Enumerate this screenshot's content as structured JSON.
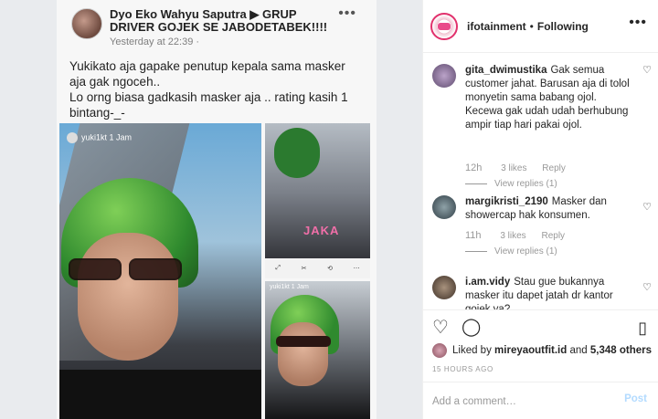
{
  "fb_post": {
    "header": "Dyo Eko Wahyu Saputra ▶ GRUP DRIVER GOJEK SE JABODETABEK!!!!",
    "time": "Yesterday at 22:39 · ",
    "more": "•••",
    "body": "Yukikato aja gapake penutup kepala sama masker aja gak ngoceh..\nLo orng biasa gadkasih masker aja .. rating kasih 1 bintang-_-",
    "photo_main_user": "yuki1kt 1 Jam",
    "photo_r1_text": "JAKA",
    "photo_r2_user": "yuki1kt 1 Jam"
  },
  "instagram": {
    "username": "ifotainment",
    "separator": "•",
    "follow_status": "Following",
    "more": "•••",
    "comments": [
      {
        "user": "gita_dwimustika",
        "text": "Gak semua customer jahat. Barusan aja di tolol monyetin sama babang ojol. Kecewa gak udah udah berhubung ampir tiap hari pakai ojol.",
        "time": "12h",
        "likes": "3 likes",
        "reply": "Reply",
        "view_replies": "View replies (1)"
      },
      {
        "user": "margikristi_2190",
        "text": "Masker dan showercap hak konsumen.",
        "time": "11h",
        "likes": "3 likes",
        "reply": "Reply",
        "view_replies": "View replies (1)"
      },
      {
        "user": "i.am.vidy",
        "text": "Stau gue bukannya masker itu dapet jatah dr kantor gojek ya?",
        "time": "",
        "likes": "",
        "reply": "",
        "view_replies": ""
      }
    ],
    "likes_prefix": "Liked by ",
    "likes_user": "mireyaoutfit.id",
    "likes_suffix": " and ",
    "likes_count": "5,348 others",
    "posted": "15 HOURS AGO",
    "add_comment_placeholder": "Add a comment…",
    "post_label": "Post"
  }
}
